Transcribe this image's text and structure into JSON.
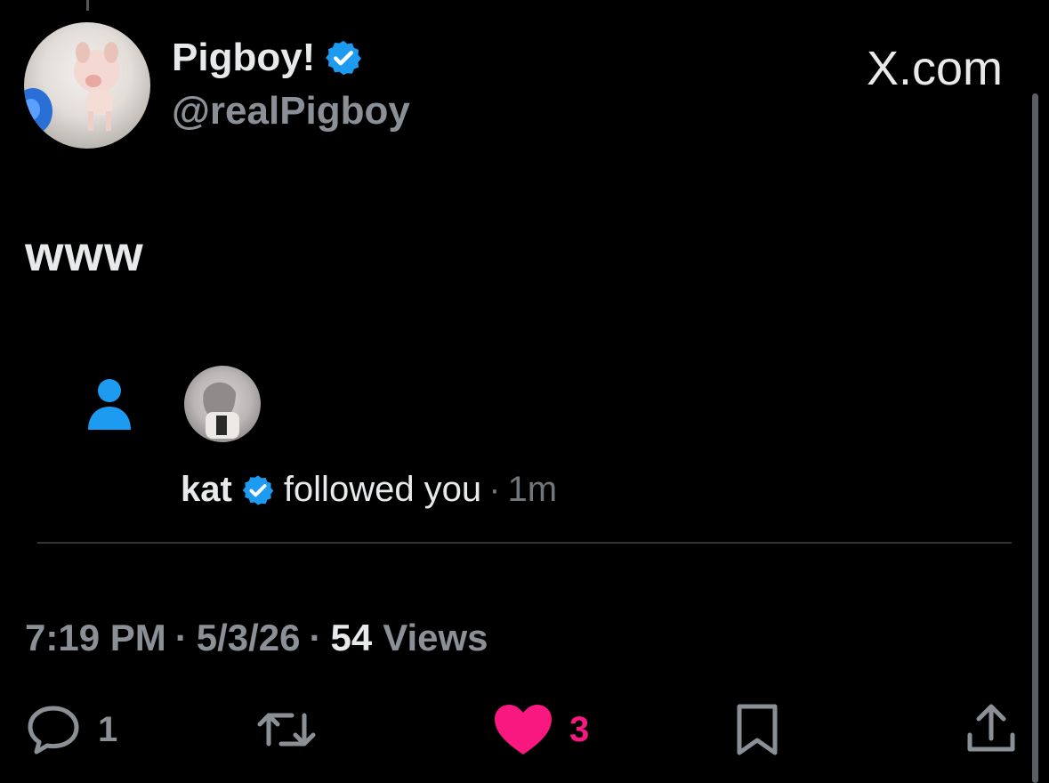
{
  "author": {
    "display_name": "Pigboy!",
    "handle": "@realPigboy",
    "verified": true
  },
  "brand": {
    "label": "X.com"
  },
  "post": {
    "text": "www"
  },
  "notification": {
    "user_name": "kat",
    "action": "followed you",
    "separator": "·",
    "time": "1m"
  },
  "meta": {
    "time": "7:19 PM",
    "sep1": "·",
    "date": "5/3/26",
    "sep2": "·",
    "views_count": "54",
    "views_label": "Views"
  },
  "actions": {
    "reply_count": "1",
    "like_count": "3"
  },
  "colors": {
    "verified_blue": "#1d9bf0",
    "like_pink": "#f91880",
    "muted_text": "#71767b"
  }
}
